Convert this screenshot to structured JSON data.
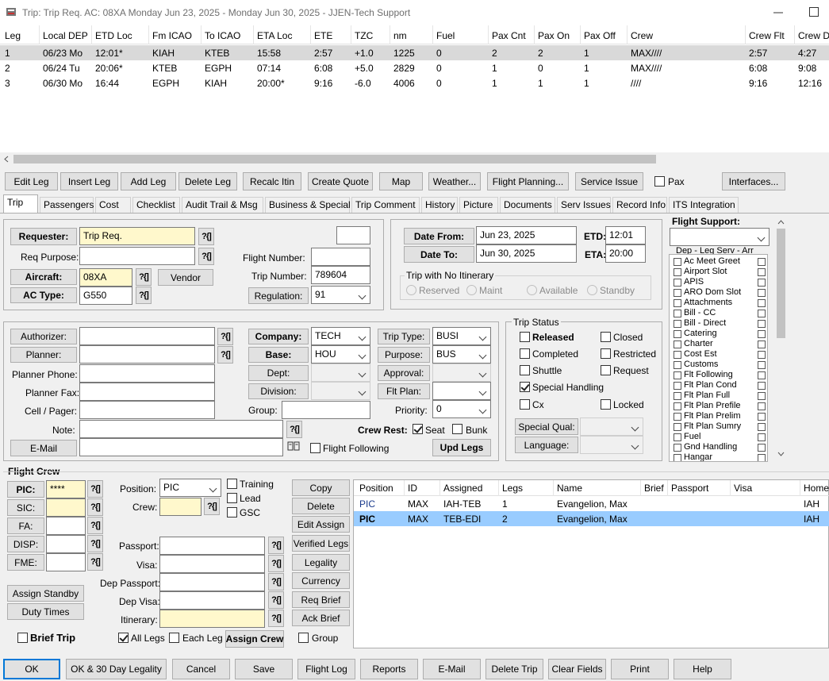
{
  "window": {
    "title": "Trip: Trip Req.  AC: 08XA  Monday Jun 23, 2025 - Monday Jun 30, 2025 - JJEN-Tech Support"
  },
  "legs_grid": {
    "columns": [
      "Leg",
      "Local DEP",
      "ETD Loc",
      "Fm ICAO",
      "To ICAO",
      "ETA Loc",
      "ETE",
      "TZC",
      "nm",
      "Fuel",
      "Pax Cnt",
      "Pax On",
      "Pax Off",
      "Crew",
      "Crew Flt",
      "Crew D"
    ],
    "rows": [
      [
        "1",
        "06/23 Mo",
        "12:01*",
        "KIAH",
        "KTEB",
        "15:58",
        "2:57",
        "+1.0",
        "1225",
        "0",
        "2",
        "2",
        "1",
        "MAX////",
        "2:57",
        "4:27"
      ],
      [
        "2",
        "06/24 Tu",
        "20:06*",
        "KTEB",
        "EGPH",
        "07:14",
        "6:08",
        "+5.0",
        "2829",
        "0",
        "1",
        "0",
        "1",
        "MAX////",
        "6:08",
        "9:08"
      ],
      [
        "3",
        "06/30 Mo",
        "16:44",
        "EGPH",
        "KIAH",
        "20:00*",
        "9:16",
        "-6.0",
        "4006",
        "0",
        "1",
        "1",
        "1",
        "////",
        "9:16",
        "12:16"
      ]
    ]
  },
  "toolbar": {
    "edit_leg": "Edit Leg",
    "insert_leg": "Insert Leg",
    "add_leg": "Add Leg",
    "delete_leg": "Delete Leg",
    "recalc": "Recalc Itin",
    "create_quote": "Create Quote",
    "map": "Map",
    "weather": "Weather...",
    "flight_planning": "Flight Planning...",
    "service_issue": "Service Issue",
    "pax": "Pax",
    "interfaces": "Interfaces..."
  },
  "tabs": [
    "Trip",
    "Passengers",
    "Cost",
    "Checklist",
    "Audit Trail & Msg",
    "Business & Special",
    "Trip Comment",
    "History",
    "Picture",
    "Documents",
    "Serv Issues",
    "Record Info",
    "ITS Integration"
  ],
  "trip": {
    "requester_label": "Requester:",
    "requester": "Trip Req.",
    "req_purpose_label": "Req Purpose:",
    "req_purpose": "",
    "aircraft_label": "Aircraft:",
    "aircraft": "08XA",
    "vendor": "Vendor",
    "ac_type_label": "AC Type:",
    "ac_type": "G550",
    "flight_number_label": "Flight Number:",
    "flight_number": "",
    "trip_number_label": "Trip Number:",
    "trip_number": "789604",
    "regulation_label": "Regulation:",
    "regulation": "91"
  },
  "dates": {
    "date_from_label": "Date From:",
    "date_from": "Jun 23, 2025",
    "date_to_label": "Date To:",
    "date_to": "Jun 30, 2025",
    "etd_label": "ETD:",
    "etd": "12:01",
    "eta_label": "ETA:",
    "eta": "20:00",
    "no_itin_title": "Trip with No Itinerary",
    "options": [
      "Reserved",
      "Maint",
      "Available",
      "Standby"
    ]
  },
  "details": {
    "authorizer": "Authorizer:",
    "planner": "Planner:",
    "planner_phone": "Planner Phone:",
    "planner_fax": "Planner Fax:",
    "cell_pager": "Cell / Pager:",
    "note": "Note:",
    "email": "E-Mail",
    "company_label": "Company:",
    "company": "TECH",
    "base_label": "Base:",
    "base": "HOU",
    "dept": "Dept:",
    "division": "Division:",
    "group": "Group:",
    "trip_type_label": "Trip Type:",
    "trip_type": "BUSI",
    "purpose_label": "Purpose:",
    "purpose": "BUS",
    "approval": "Approval:",
    "flt_plan": "Flt Plan:",
    "priority_label": "Priority:",
    "priority": "0",
    "crew_rest": "Crew Rest:",
    "seat": "Seat",
    "bunk": "Bunk",
    "flight_following": "Flight Following",
    "upd_legs": "Upd Legs"
  },
  "trip_status": {
    "title": "Trip Status",
    "released": "Released",
    "completed": "Completed",
    "shuttle": "Shuttle",
    "special_handling": "Special Handling",
    "cx": "Cx",
    "closed": "Closed",
    "restricted": "Restricted",
    "request": "Request",
    "locked": "Locked",
    "special_qual": "Special Qual:",
    "language": "Language:"
  },
  "flight_support": {
    "title": "Flight Support:",
    "list_title": "Dep - Leg Serv - Arr",
    "items": [
      "Ac Meet Greet",
      "Airport Slot",
      "APIS",
      "ARO Dom Slot",
      "Attachments",
      "Bill - CC",
      "Bill - Direct",
      "Catering",
      "Charter",
      "Cost Est",
      "Customs",
      "Flt Following",
      "Flt Plan Cond",
      "Flt Plan Full",
      "Flt Plan Prefile",
      "Flt Plan Prelim",
      "Flt Plan Sumry",
      "Fuel",
      "Gnd Handling",
      "Hangar"
    ]
  },
  "flight_crew": {
    "title": "Flight Crew",
    "pic": "PIC:",
    "pic_value": "****",
    "sic": "SIC:",
    "fa": "FA:",
    "disp": "DISP:",
    "fme": "FME:",
    "position_label": "Position:",
    "position": "PIC",
    "crew_label": "Crew:",
    "training": "Training",
    "lead": "Lead",
    "gsc": "GSC",
    "passport": "Passport:",
    "visa": "Visa:",
    "dep_passport": "Dep Passport:",
    "dep_visa": "Dep Visa:",
    "itinerary": "Itinerary:",
    "assign_standby": "Assign Standby",
    "duty_times": "Duty Times",
    "brief_trip": "Brief Trip",
    "all_legs": "All Legs",
    "each_leg": "Each Leg",
    "assign_crew": "Assign Crew",
    "group": "Group",
    "copy": "Copy",
    "delete": "Delete",
    "edit_assign": "Edit Assign",
    "verified_legs": "Verified Legs",
    "legality": "Legality",
    "currency": "Currency",
    "req_brief": "Req Brief",
    "ack_brief": "Ack Brief"
  },
  "crew_grid": {
    "columns": [
      "Position",
      "ID",
      "Assigned",
      "Legs",
      "Name",
      "Brief",
      "Passport",
      "Visa",
      "Home"
    ],
    "rows": [
      [
        "PIC",
        "MAX",
        "IAH-TEB",
        "1",
        "Evangelion, Max",
        "",
        "",
        "",
        "IAH"
      ],
      [
        "PIC",
        "MAX",
        "TEB-EDI",
        "2",
        "Evangelion, Max",
        "",
        "",
        "",
        "IAH"
      ]
    ]
  },
  "footer": {
    "ok": "OK",
    "ok30": "OK & 30 Day Legality",
    "cancel": "Cancel",
    "save": "Save",
    "flight_log": "Flight Log",
    "reports": "Reports",
    "email": "E-Mail",
    "delete_trip": "Delete Trip",
    "clear_fields": "Clear Fields",
    "print": "Print",
    "help": "Help"
  },
  "icons": {
    "lookup": "lookup-icon",
    "app": "app-icon",
    "book": "book-icon"
  }
}
